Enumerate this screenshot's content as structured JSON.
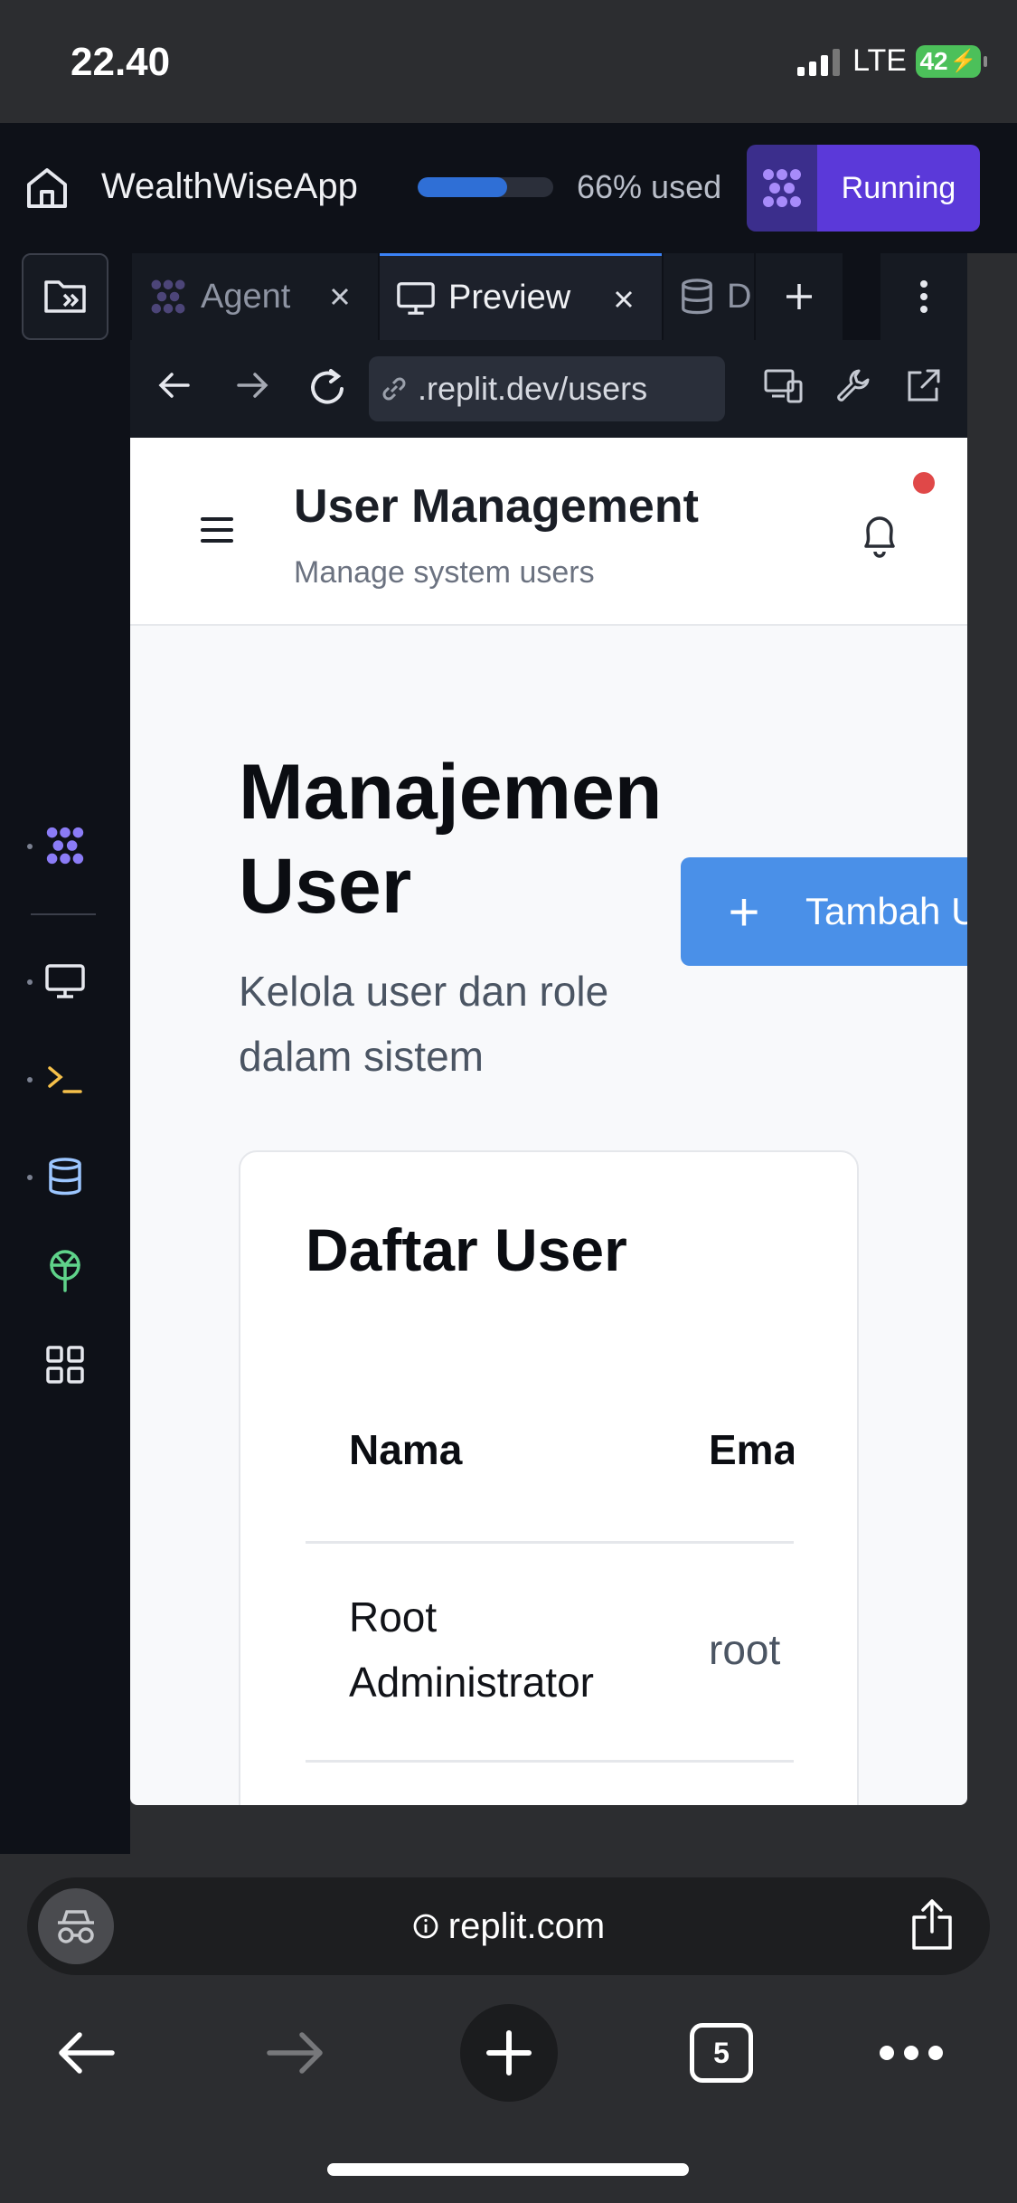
{
  "status_bar": {
    "time": "22.40",
    "network": "LTE",
    "battery": "42"
  },
  "replit": {
    "app_name": "WealthWiseApp",
    "usage": {
      "percent": 66,
      "label": "66% used"
    },
    "run_button": "Running",
    "tabs": [
      {
        "label": "Agent",
        "active": false
      },
      {
        "label": "Preview",
        "active": true
      },
      {
        "label": "D",
        "active": false
      }
    ],
    "url": ".replit.dev/users"
  },
  "preview_page": {
    "header": {
      "title": "User Management",
      "subtitle": "Manage system users"
    },
    "heading": "Manajemen User",
    "description": "Kelola user dan role dalam sistem",
    "add_button": "Tambah U",
    "card": {
      "title": "Daftar User",
      "columns": [
        "Nama",
        "Ema"
      ],
      "rows": [
        {
          "name_line1": "Root",
          "name_line2": "Administrator",
          "email": "root"
        }
      ]
    }
  },
  "browser": {
    "domain": "replit.com",
    "tab_count": "5"
  },
  "colors": {
    "accent": "#5b39d9",
    "preview_tab_border": "#3b82f6",
    "add_button": "#4a90e8",
    "notification_dot": "#e04848",
    "battery": "#4cc05a"
  },
  "icons": {
    "rail": [
      "file-explorer-icon",
      "agent-icon",
      "preview-icon",
      "shell-icon",
      "database-icon",
      "deployments-icon",
      "all-tools-icon"
    ]
  }
}
